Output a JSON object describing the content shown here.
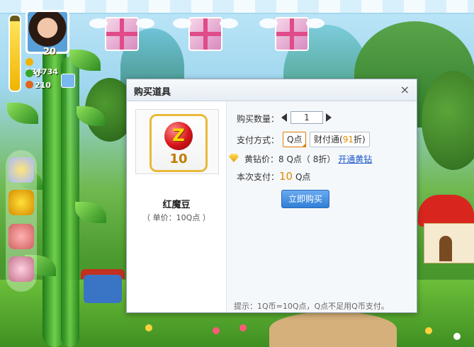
{
  "hud": {
    "level": "20",
    "coins": "134734",
    "clovers": "0",
    "gems": "210",
    "energy_fraction": 0.92
  },
  "dialog": {
    "title": "购买道具",
    "close_label": "×",
    "item": {
      "badge_letter": "Z",
      "badge_quantity": "10",
      "name": "红魔豆",
      "unit_price": "（ 单价：10Q点 ）"
    },
    "quantity_label": "购买数量：",
    "quantity_value": "1",
    "payment_label": "支付方式：",
    "payment_options": {
      "q_points": "Q点",
      "tenpay_prefix": "财付通(",
      "tenpay_discount": "91",
      "tenpay_suffix": "折)"
    },
    "vip_label": "黄钻价：",
    "vip_price": "8 Q点（ 8折）",
    "vip_link": "开通黄钻",
    "total_label": "本次支付：",
    "total_amount": "10",
    "total_unit": "Q点",
    "buy_button": "立即购买",
    "hint": "提示：1Q币=10Q点，Q点不足用Q币支付。"
  },
  "colors": {
    "dialog_header": "#e6edf4",
    "buy_button": "#2f7fd6",
    "accent_orange": "#e08a00",
    "link_blue": "#1a56c8"
  }
}
